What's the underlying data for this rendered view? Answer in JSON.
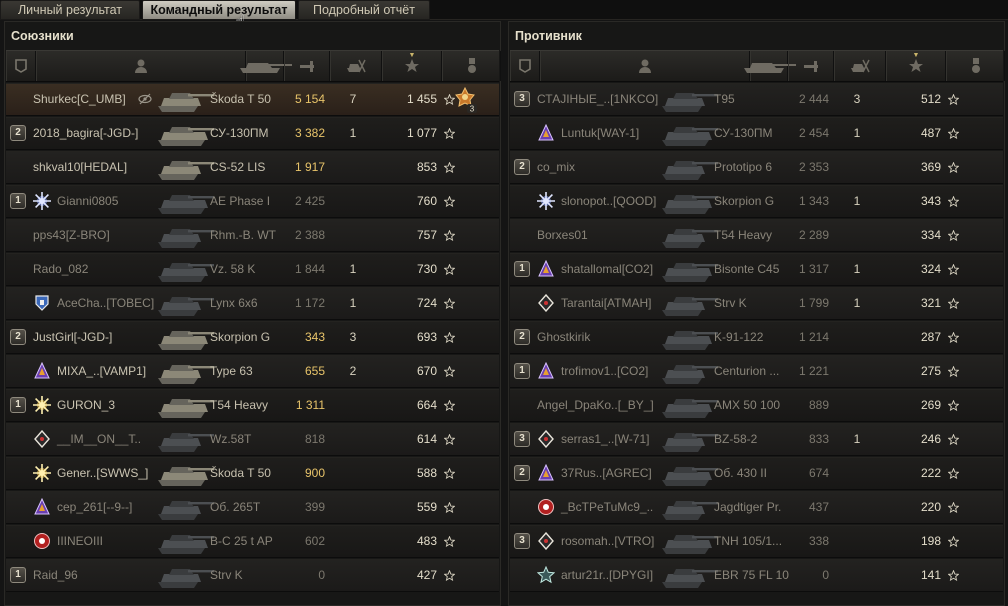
{
  "tabs": [
    {
      "label": "Личный результат"
    },
    {
      "label": "Командный результат",
      "active": true
    },
    {
      "label": "Подробный отчёт"
    }
  ],
  "colors": {
    "accent_yellow": "#e8c46a",
    "active_tab": "#cfccc2",
    "highlight_row": "#3a2e22"
  },
  "allies": {
    "title": "Союзники",
    "header_icons": [
      "squad-icon",
      "player-icon",
      "tank-icon",
      "damage-icon",
      "kills-icon",
      "xp-star-icon",
      "medal-icon"
    ],
    "rows": [
      {
        "squad": "",
        "badge": "",
        "name": "Shurkec[C_UMB]",
        "tank": "Škoda T 50",
        "damage": "5 154",
        "dmg_style": "y",
        "kills": "7",
        "xp": "1 455",
        "highlight": true,
        "eye": true,
        "medal": "3"
      },
      {
        "squad": "2",
        "badge": "",
        "name": "2018_bagira[-JGD-]",
        "tank": "СУ-130ПМ",
        "damage": "3 382",
        "dmg_style": "y",
        "kills": "1",
        "xp": "1 077"
      },
      {
        "squad": "",
        "badge": "",
        "name": "shkval10[HEDAL]",
        "tank": "CS-52 LIS",
        "damage": "1 917",
        "dmg_style": "y",
        "kills": "",
        "xp": "853"
      },
      {
        "squad": "1",
        "badge": "snowflake",
        "name": "Gianni0805",
        "tank": "AE Phase I",
        "damage": "2 425",
        "dmg_style": "g",
        "kills": "",
        "xp": "760",
        "dead": true
      },
      {
        "squad": "",
        "badge": "",
        "name": "pps43[Z-BRO]",
        "tank": "Rhm.-B. WT",
        "damage": "2 388",
        "dmg_style": "g",
        "kills": "",
        "xp": "757",
        "dead": true
      },
      {
        "squad": "",
        "badge": "",
        "name": "Rado_082",
        "tank": "Vz. 58 K",
        "damage": "1 844",
        "dmg_style": "g",
        "kills": "1",
        "xp": "730",
        "dead": true
      },
      {
        "squad": "",
        "badge": "shield",
        "name": "AceCha..[TOBEC]",
        "tank": "Lynx 6x6",
        "damage": "1 172",
        "dmg_style": "g",
        "kills": "1",
        "xp": "724",
        "dead": true
      },
      {
        "squad": "2",
        "badge": "",
        "name": "JustGirl[-JGD-]",
        "tank": "Skorpion G",
        "damage": "343",
        "dmg_style": "y",
        "kills": "3",
        "xp": "693"
      },
      {
        "squad": "",
        "badge": "purple",
        "name": "MIXA_..[VAMP1]",
        "tank": "Type 63",
        "damage": "655",
        "dmg_style": "y",
        "kills": "2",
        "xp": "670"
      },
      {
        "squad": "1",
        "badge": "gold",
        "name": "GURON_3",
        "tank": "T54 Heavy",
        "damage": "1 311",
        "dmg_style": "y",
        "kills": "",
        "xp": "664"
      },
      {
        "squad": "",
        "badge": "diamond",
        "name": "__IM__ON__T..",
        "tank": "Wz.58T",
        "damage": "818",
        "dmg_style": "g",
        "kills": "",
        "xp": "614",
        "dead": true
      },
      {
        "squad": "",
        "badge": "gold",
        "name": "Gener..[SWWS_]",
        "tank": "Škoda T 50",
        "damage": "900",
        "dmg_style": "y",
        "kills": "",
        "xp": "588"
      },
      {
        "squad": "",
        "badge": "purple",
        "name": "cep_261[--9--]",
        "tank": "Об. 265Т",
        "damage": "399",
        "dmg_style": "g",
        "kills": "",
        "xp": "559",
        "dead": true
      },
      {
        "squad": "",
        "badge": "red",
        "name": "IIINEOIII",
        "tank": "B-C 25 t AP",
        "damage": "602",
        "dmg_style": "g",
        "kills": "",
        "xp": "483",
        "dead": true
      },
      {
        "squad": "1",
        "badge": "",
        "name": "Raid_96",
        "tank": "Strv K",
        "damage": "0",
        "dmg_style": "g",
        "kills": "",
        "xp": "427",
        "dead": true
      }
    ]
  },
  "enemies": {
    "title": "Противник",
    "header_icons": [
      "squad-icon",
      "player-icon",
      "tank-icon",
      "damage-icon",
      "kills-icon",
      "xp-star-icon",
      "medal-icon"
    ],
    "rows": [
      {
        "squad": "3",
        "badge": "",
        "name": "СТАЈІНЫЕ_..[1NKCO]",
        "tank": "T95",
        "damage": "2 444",
        "dmg_style": "g",
        "kills": "3",
        "xp": "512",
        "dead": true
      },
      {
        "squad": "",
        "badge": "purple",
        "name": "Luntuk[WAY-1]",
        "tank": "СУ-130ПМ",
        "damage": "2 454",
        "dmg_style": "g",
        "kills": "1",
        "xp": "487",
        "dead": true
      },
      {
        "squad": "2",
        "badge": "",
        "name": "co_mix",
        "tank": "Prototipo 6",
        "damage": "2 353",
        "dmg_style": "g",
        "kills": "",
        "xp": "369",
        "dead": true
      },
      {
        "squad": "",
        "badge": "snowflake",
        "name": "slonopot..[QOOD]",
        "tank": "Skorpion G",
        "damage": "1 343",
        "dmg_style": "g",
        "kills": "1",
        "xp": "343",
        "dead": true
      },
      {
        "squad": "",
        "badge": "",
        "name": "Borxes01",
        "tank": "T54 Heavy",
        "damage": "2 289",
        "dmg_style": "g",
        "kills": "",
        "xp": "334",
        "dead": true
      },
      {
        "squad": "1",
        "badge": "purple",
        "name": "shatallomal[CO2]",
        "tank": "Bisonte C45",
        "damage": "1 317",
        "dmg_style": "g",
        "kills": "1",
        "xp": "324",
        "dead": true
      },
      {
        "squad": "",
        "badge": "diamond",
        "name": "Tarantai[ATMAH]",
        "tank": "Strv K",
        "damage": "1 799",
        "dmg_style": "g",
        "kills": "1",
        "xp": "321",
        "dead": true
      },
      {
        "squad": "2",
        "badge": "",
        "name": "Ghostkirik",
        "tank": "K-91-122",
        "damage": "1 214",
        "dmg_style": "g",
        "kills": "",
        "xp": "287",
        "dead": true
      },
      {
        "squad": "1",
        "badge": "purple",
        "name": "trofimov1..[CO2]",
        "tank": "Centurion ...",
        "damage": "1 221",
        "dmg_style": "g",
        "kills": "",
        "xp": "275",
        "dead": true
      },
      {
        "squad": "",
        "badge": "",
        "name": "Angel_DpaKo..[_BY_]",
        "tank": "AMX 50 100",
        "damage": "889",
        "dmg_style": "g",
        "kills": "",
        "xp": "269",
        "dead": true
      },
      {
        "squad": "3",
        "badge": "diamond",
        "name": "serras1_..[W-71]",
        "tank": "BZ-58-2",
        "damage": "833",
        "dmg_style": "g",
        "kills": "1",
        "xp": "246",
        "dead": true
      },
      {
        "squad": "2",
        "badge": "purple",
        "name": "37Rus..[AGREC]",
        "tank": "Об. 430 II",
        "damage": "674",
        "dmg_style": "g",
        "kills": "",
        "xp": "222",
        "dead": true
      },
      {
        "squad": "",
        "badge": "red",
        "name": "_BcTPeTuMc9_..",
        "tank": "Jagdtiger Pr.",
        "damage": "437",
        "dmg_style": "g",
        "kills": "",
        "xp": "220",
        "dead": true
      },
      {
        "squad": "3",
        "badge": "diamond",
        "name": "rosomah..[VTRO]",
        "tank": "TNH 105/1...",
        "damage": "338",
        "dmg_style": "g",
        "kills": "",
        "xp": "198",
        "dead": true
      },
      {
        "squad": "",
        "badge": "star",
        "name": "artur21r..[DPYGI]",
        "tank": "EBR 75 FL 10",
        "damage": "0",
        "dmg_style": "g",
        "kills": "",
        "xp": "141",
        "dead": true
      }
    ]
  }
}
